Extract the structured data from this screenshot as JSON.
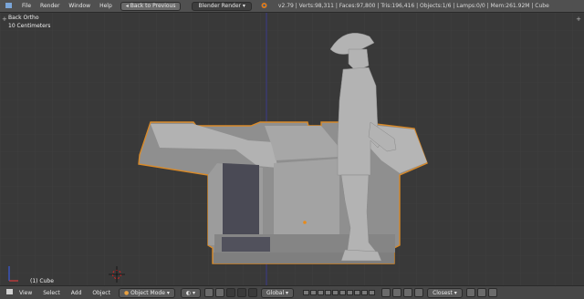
{
  "header": {
    "menu": [
      "File",
      "Render",
      "Window",
      "Help"
    ],
    "back_label": "Back to Previous",
    "engine": "Blender Render",
    "stats": "v2.79 | Verts:98,311 | Faces:97,800 | Tris:196,416 | Objects:1/6 | Lamps:0/0 | Mem:261.92M | Cube"
  },
  "viewport": {
    "view_name": "Back Ortho",
    "scale": "10 Centimeters",
    "object_label": "(1) Cube"
  },
  "footer": {
    "menu": [
      "View",
      "Select",
      "Add",
      "Object"
    ],
    "mode": "Object Mode",
    "orientation": "Global",
    "snap": "Closest"
  },
  "colors": {
    "background": "#393939",
    "header": "#505050",
    "selection_outline": "#d88a2a",
    "model": "#a9a9a9"
  }
}
